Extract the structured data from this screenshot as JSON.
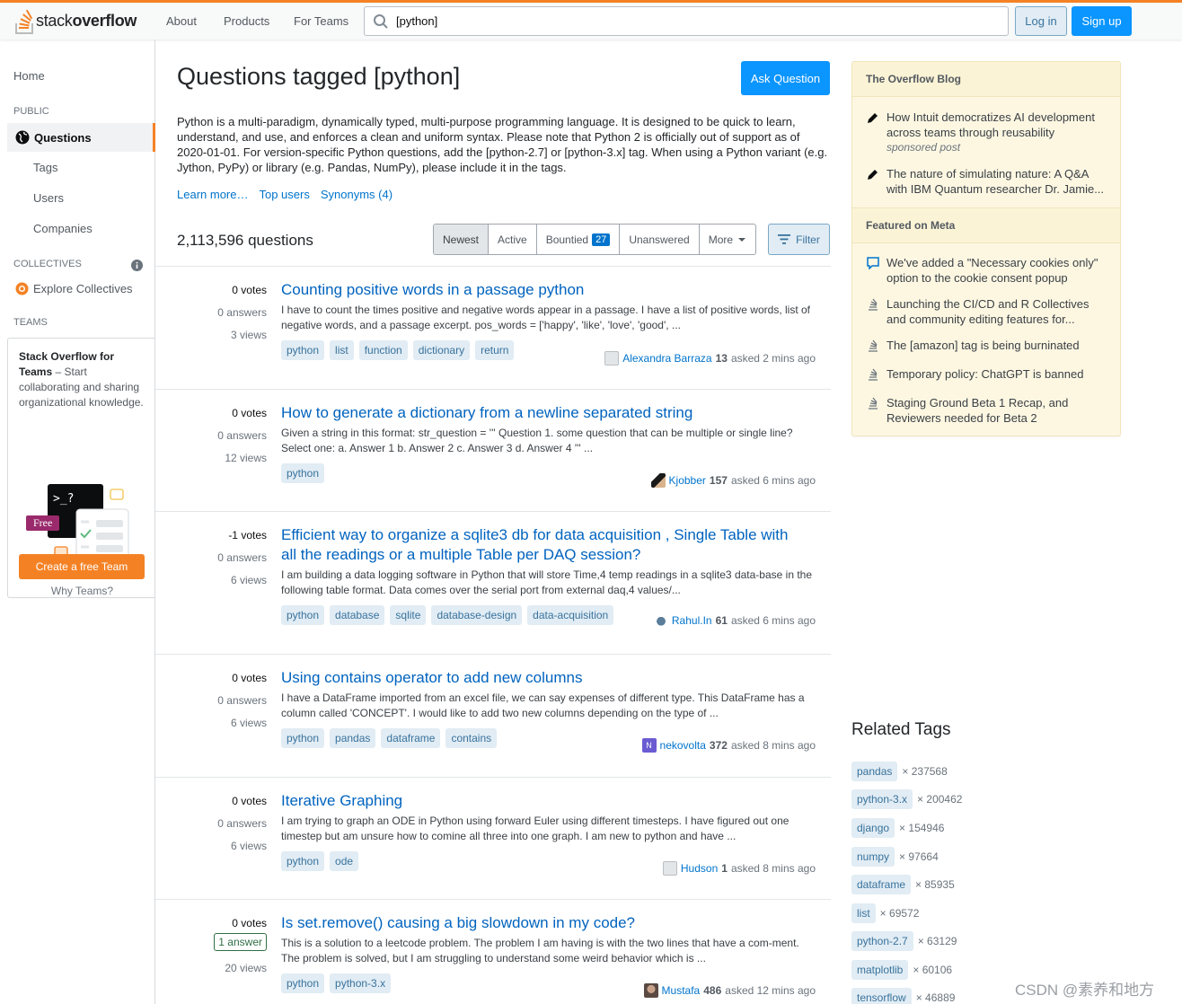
{
  "header": {
    "logo_text_a": "stack",
    "logo_text_b": "overflow",
    "nav": [
      "About",
      "Products",
      "For Teams"
    ],
    "search_value": "[python]",
    "login_label": "Log in",
    "signup_label": "Sign up",
    "accent_color": "#f48225"
  },
  "sidebar": {
    "home": "Home",
    "public_label": "PUBLIC",
    "questions": "Questions",
    "tags": "Tags",
    "users": "Users",
    "companies": "Companies",
    "collectives_label": "COLLECTIVES",
    "explore_collectives": "Explore Collectives",
    "teams_label": "TEAMS",
    "teams_title": "Stack Overflow for Teams",
    "teams_dash": " – Start collaborating and sharing organizational knowledge.",
    "free_badge": "Free",
    "create_team": "Create a free Team",
    "why_teams": "Why Teams?"
  },
  "main": {
    "title": "Questions tagged [python]",
    "ask_button": "Ask Question",
    "description": "Python is a multi-paradigm, dynamically typed, multi-purpose programming language. It is designed to be quick to learn, understand, and use, and enforces a clean and uniform syntax. Please note that Python 2 is officially out of support as of 2020-01-01. For version-specific Python questions, add the [python-2.7] or [python-3.x] tag. When using a Python variant (e.g. Jython, PyPy) or library (e.g. Pandas, NumPy), please include it in the tags.",
    "learn_more": "Learn more…",
    "top_users": "Top users",
    "synonyms": "Synonyms (4)",
    "question_count": "2,113,596 questions",
    "filters": [
      "Newest",
      "Active",
      "Bountied",
      "Unanswered",
      "More"
    ],
    "bounty_count": "27",
    "filter_button": "Filter"
  },
  "questions": [
    {
      "votes": "0 votes",
      "answers": "0 answers",
      "views": "3 views",
      "title": "Counting positive words in a passage python",
      "excerpt": "I have to count the times positive and negative words appear in a passage. I have a list of positive words, list of negative words, and a passage excerpt. pos_words = ['happy', 'like', 'love', 'good', ...",
      "tags": [
        "python",
        "list",
        "function",
        "dictionary",
        "return"
      ],
      "user": "Alexandra Barraza",
      "rep": "13",
      "asked": "asked 2 mins ago"
    },
    {
      "votes": "0 votes",
      "answers": "0 answers",
      "views": "12 views",
      "title": "How to generate a dictionary from a newline separated string",
      "excerpt": "Given a string in this format: str_question = ''' Question 1. some question that can be multiple or single line? Select one: a. Answer 1 b. Answer 2 c. Answer 3 d. Answer 4 ''' ...",
      "tags": [
        "python"
      ],
      "user": "Kjobber",
      "rep": "157",
      "asked": "asked 6 mins ago"
    },
    {
      "votes": "-1 votes",
      "answers": "0 answers",
      "views": "6 views",
      "title": "Efficient way to organize a sqlite3 db for data acquisition , Single Table with all the readings or a multiple Table per DAQ session?",
      "excerpt": "I am building a data logging software in Python that will store Time,4 temp readings in a sqlite3 data-base in the following table format. Data comes over the serial port from external daq,4 values/...",
      "tags": [
        "python",
        "database",
        "sqlite",
        "database-design",
        "data-acquisition"
      ],
      "user": "Rahul.In",
      "rep": "61",
      "asked": "asked 6 mins ago"
    },
    {
      "votes": "0 votes",
      "answers": "0 answers",
      "views": "6 views",
      "title": "Using contains operator to add new columns",
      "excerpt": "I have a DataFrame imported from an excel file, we can say expenses of different type. This DataFrame has a column called 'CONCEPT'. I would like to add two new columns depending on the type of ...",
      "tags": [
        "python",
        "pandas",
        "dataframe",
        "contains"
      ],
      "user": "nekovolta",
      "rep": "372",
      "asked": "asked 8 mins ago"
    },
    {
      "votes": "0 votes",
      "answers": "0 answers",
      "views": "6 views",
      "title": "Iterative Graphing",
      "excerpt": "I am trying to graph an ODE in Python using forward Euler using different timesteps. I have figured out one timestep but am unsure how to comine all three into one graph. I am new to python and have ...",
      "tags": [
        "python",
        "ode"
      ],
      "user": "Hudson",
      "rep": "1",
      "asked": "asked 8 mins ago"
    },
    {
      "votes": "0 votes",
      "answers": "1 answer",
      "views": "20 views",
      "title": "Is set.remove() causing a big slowdown in my code?",
      "excerpt": "This is a solution to a leetcode problem. The problem I am having is with the two lines that have a com-ment. The problem is solved, but I am struggling to understand some weird behavior which is ...",
      "tags": [
        "python",
        "python-3.x"
      ],
      "user": "Mustafa",
      "rep": "486",
      "asked": "asked 12 mins ago"
    }
  ],
  "blog": {
    "heading": "The Overflow Blog",
    "items": [
      {
        "text": "How Intuit democratizes AI development across teams through reusability",
        "sub": "sponsored post"
      },
      {
        "text": "The nature of simulating nature: A Q&A with IBM Quantum researcher Dr. Jamie..."
      }
    ],
    "meta_heading": "Featured on Meta",
    "meta_items": [
      "We've added a \"Necessary cookies only\" option to the cookie consent popup",
      "Launching the CI/CD and R Collectives and community editing features for...",
      "The [amazon] tag is being burninated",
      "Temporary policy: ChatGPT is banned",
      "Staging Ground Beta 1 Recap, and Reviewers needed for Beta 2"
    ]
  },
  "related": {
    "title": "Related Tags",
    "tags": [
      {
        "name": "pandas",
        "count": "× 237568"
      },
      {
        "name": "python-3.x",
        "count": "× 200462"
      },
      {
        "name": "django",
        "count": "× 154946"
      },
      {
        "name": "numpy",
        "count": "× 97664"
      },
      {
        "name": "dataframe",
        "count": "× 85935"
      },
      {
        "name": "list",
        "count": "× 69572"
      },
      {
        "name": "python-2.7",
        "count": "× 63129"
      },
      {
        "name": "matplotlib",
        "count": "× 60106"
      },
      {
        "name": "tensorflow",
        "count": "× 46889"
      }
    ]
  },
  "watermark": "CSDN @素养和地方"
}
